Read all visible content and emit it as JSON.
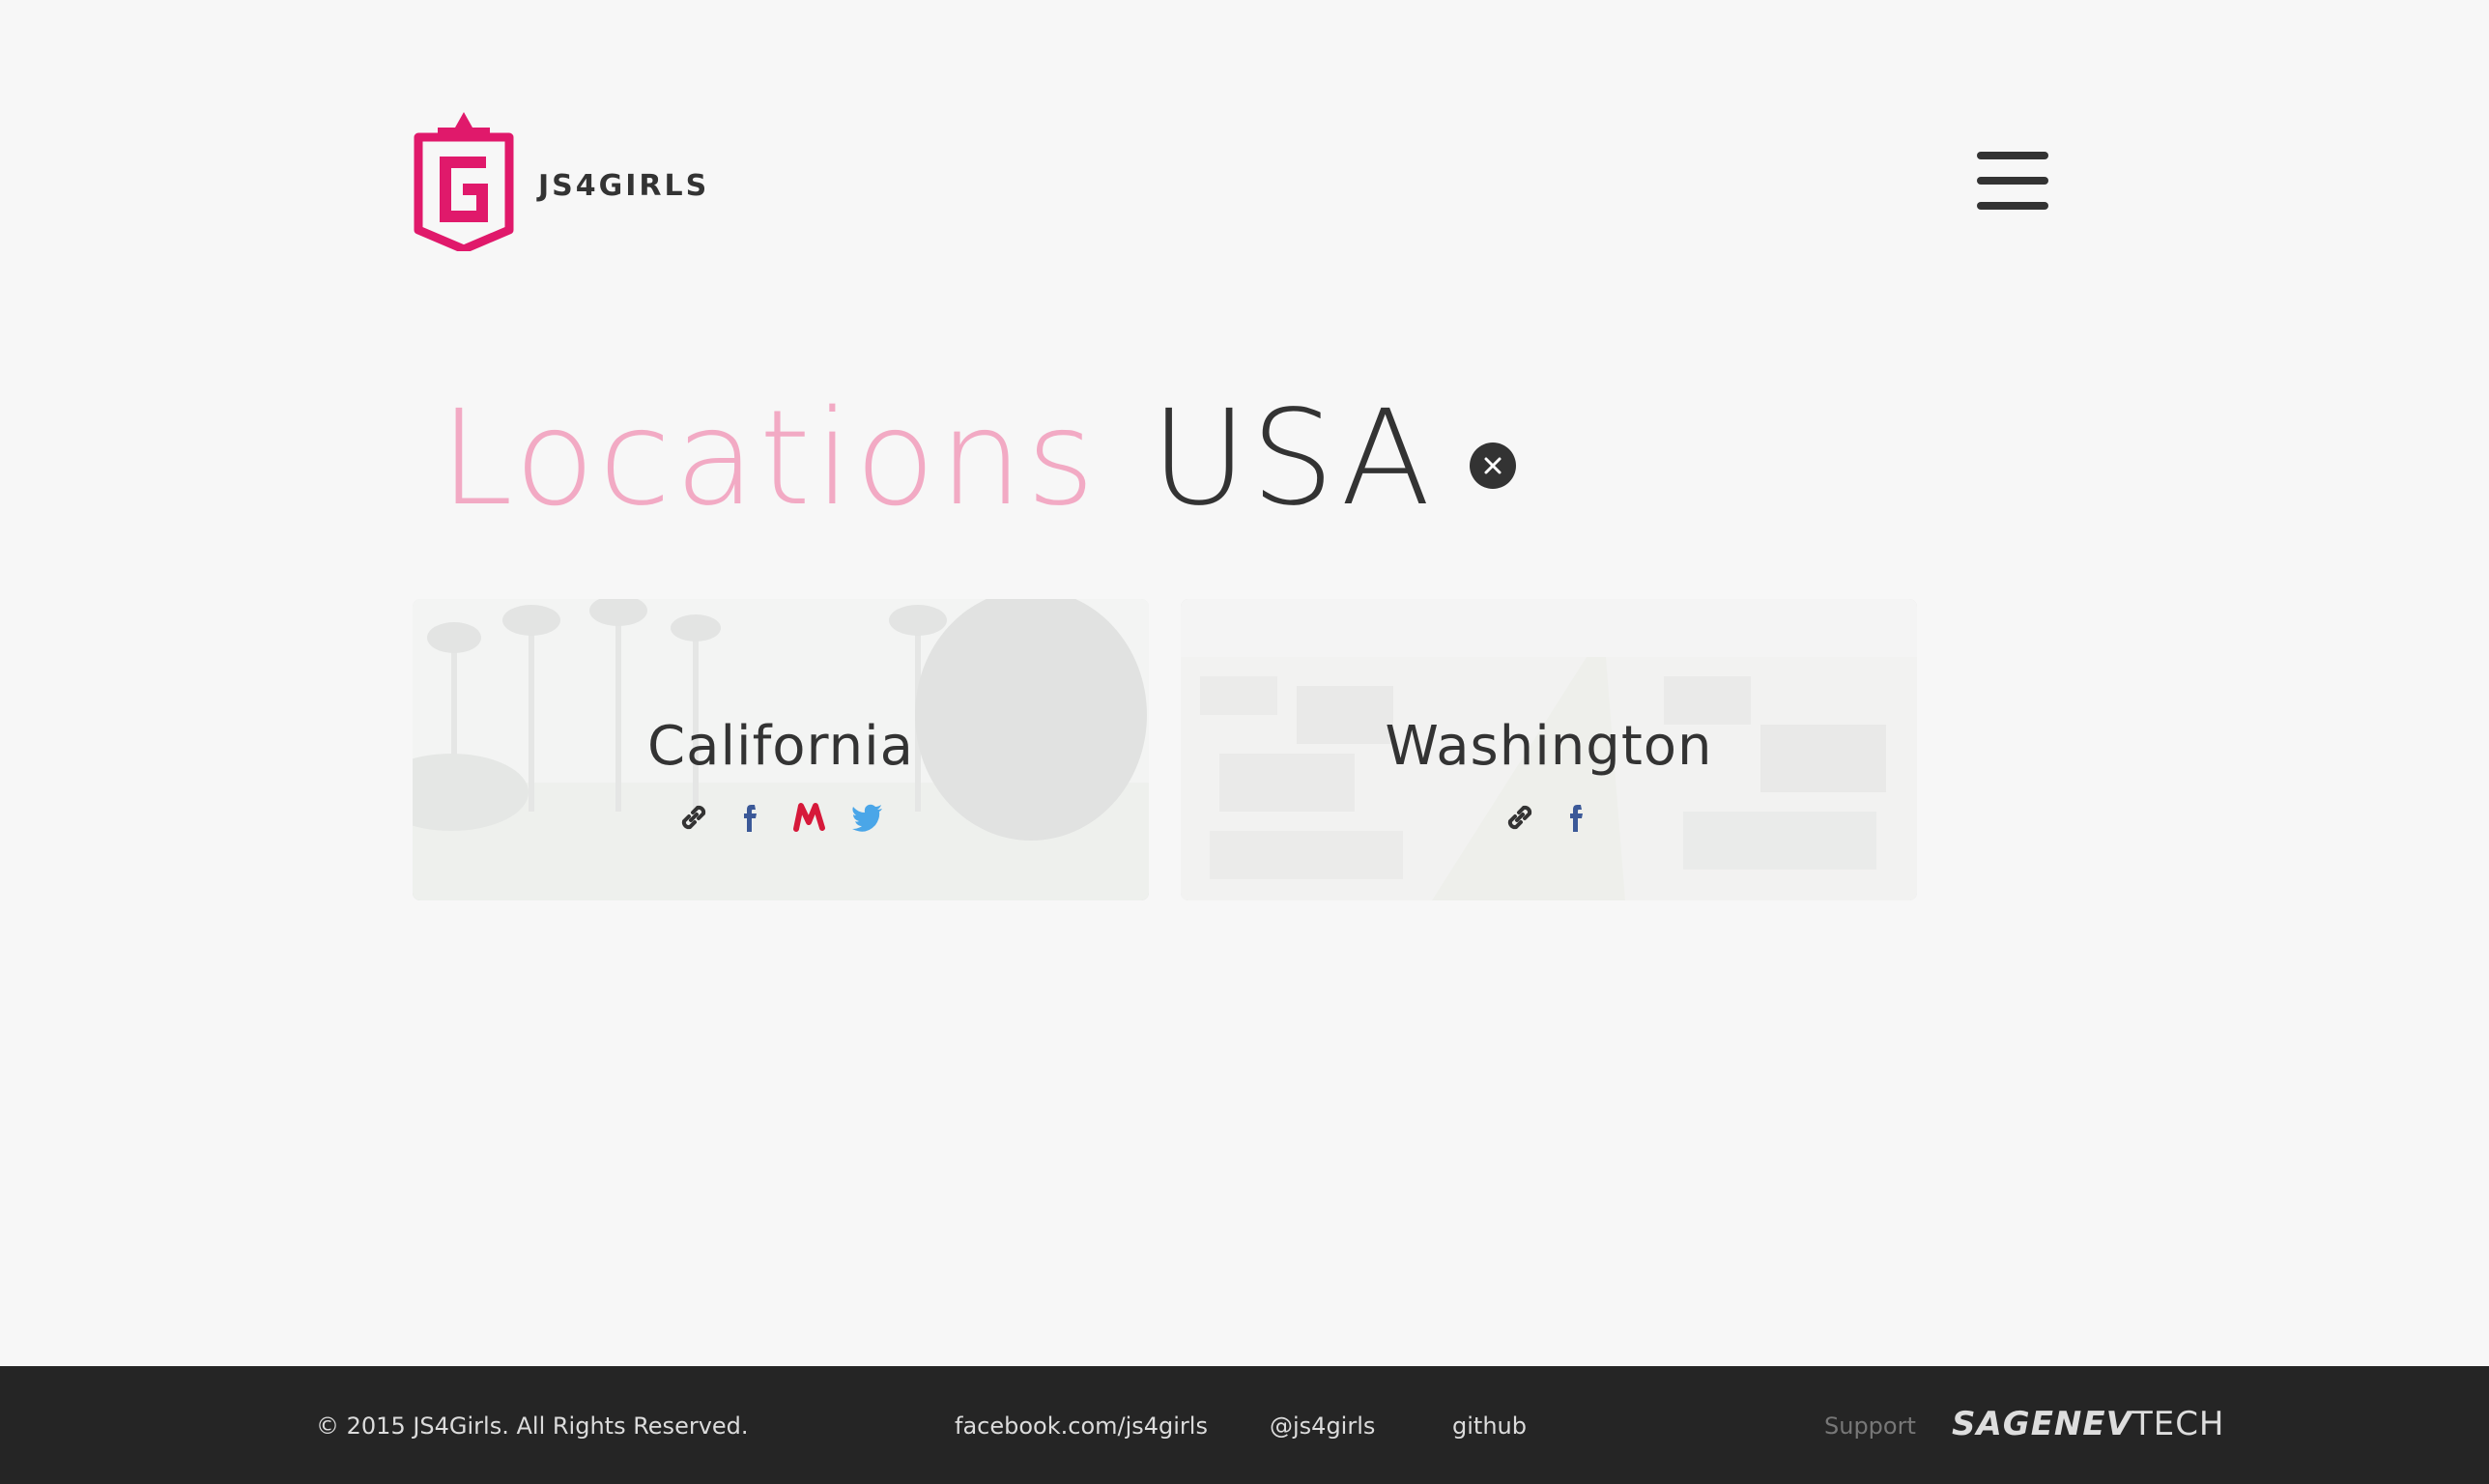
{
  "header": {
    "logo_text": "JS4GIRLS",
    "brand_color": "#e0196b",
    "menu_icon": "hamburger-icon"
  },
  "page": {
    "title": "Locations",
    "subtitle": "USA",
    "close_icon": "close-icon"
  },
  "locations": [
    {
      "name": "California",
      "links": [
        "link-icon",
        "facebook-icon",
        "meetup-icon",
        "twitter-icon"
      ]
    },
    {
      "name": "Washington",
      "links": [
        "link-icon",
        "facebook-icon"
      ]
    }
  ],
  "footer": {
    "copyright": "© 2015 JS4Girls. All Rights Reserved.",
    "facebook": "facebook.com/js4girls",
    "twitter": "@js4girls",
    "github": "github",
    "support": "Support",
    "sponsor_bold": "SAGENEV",
    "sponsor_light": "TECH"
  }
}
